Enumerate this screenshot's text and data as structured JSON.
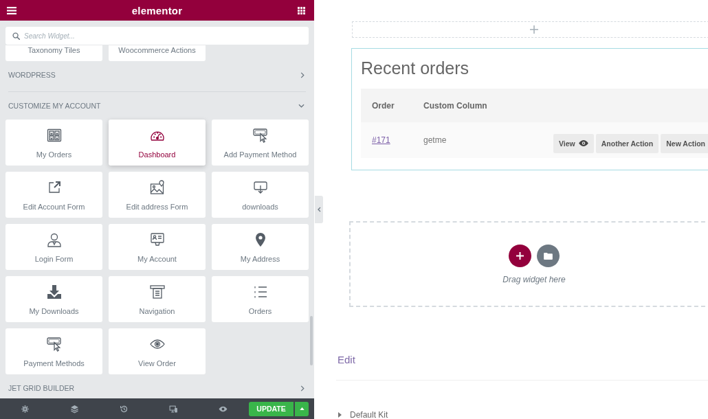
{
  "panel": {
    "header": {
      "title": "elementor"
    },
    "search": {
      "placeholder": "Search Widget..."
    },
    "scrolled_widgets": [
      {
        "label": "Taxonomy Tiles"
      },
      {
        "label": "Woocommerce Actions"
      }
    ],
    "categories": [
      {
        "title": "WORDPRESS",
        "expanded": false
      },
      {
        "title": "CUSTOMIZE MY ACCOUNT",
        "expanded": true,
        "widgets": [
          {
            "label": "My Orders",
            "selected": false
          },
          {
            "label": "Dashboard",
            "selected": true
          },
          {
            "label": "Add Payment Method",
            "selected": false
          },
          {
            "label": "Edit Account Form",
            "selected": false
          },
          {
            "label": "Edit address Form",
            "selected": false
          },
          {
            "label": "downloads",
            "selected": false
          },
          {
            "label": "Login Form",
            "selected": false
          },
          {
            "label": "My Account",
            "selected": false
          },
          {
            "label": "My Address",
            "selected": false
          },
          {
            "label": "My Downloads",
            "selected": false
          },
          {
            "label": "Navigation",
            "selected": false
          },
          {
            "label": "Orders",
            "selected": false
          },
          {
            "label": "Payment Methods",
            "selected": false
          },
          {
            "label": "View Order",
            "selected": false
          }
        ]
      },
      {
        "title": "JET GRID BUILDER",
        "expanded": false
      }
    ],
    "footer": {
      "update_button": "UPDATE"
    }
  },
  "canvas": {
    "recent_orders": {
      "title": "Recent orders",
      "columns": [
        "Order",
        "Custom Column"
      ],
      "rows": [
        {
          "order": "#171",
          "custom_column": "getme",
          "actions": [
            {
              "label": "View",
              "kind": "view"
            },
            {
              "label": "Another Action",
              "kind": "custom"
            },
            {
              "label": "New Action",
              "kind": "custom"
            }
          ]
        }
      ]
    },
    "drop_zone": {
      "hint": "Drag widget here"
    },
    "edit_link": "Edit",
    "bottom_item": {
      "label": "Default Kit"
    }
  }
}
